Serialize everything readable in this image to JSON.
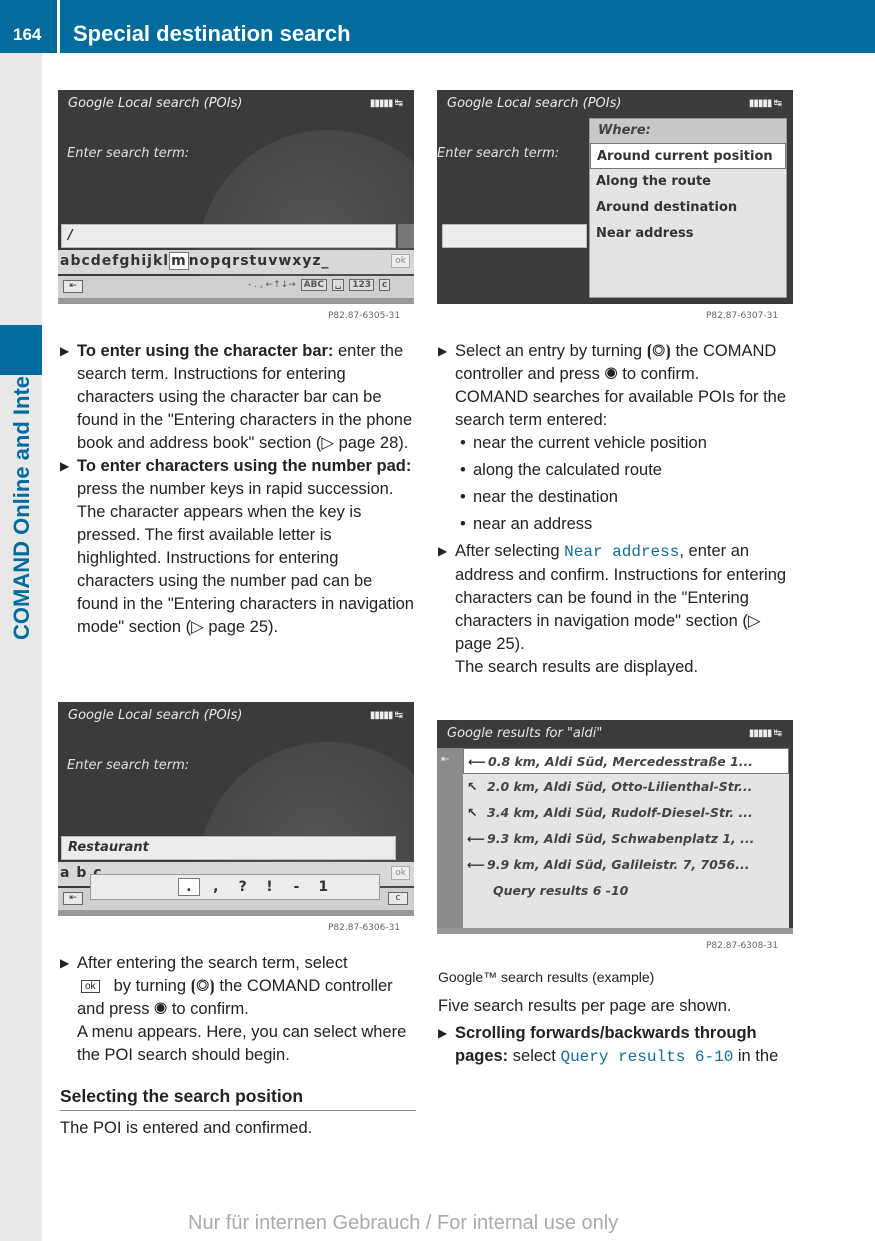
{
  "header": {
    "page_number": "164",
    "title": "Special destination search"
  },
  "sidebar": {
    "chapter": "COMAND Online and Internet"
  },
  "screens": {
    "s1": {
      "title": "Google Local search (POIs)",
      "status": "▮▮▮▮▮ ↹",
      "label": "Enter search term:",
      "input_value": "/",
      "charbar_before": "abcdefghijkl",
      "charbar_selected": "m",
      "charbar_after": "nopqrstuvwxyz_",
      "ok_key": "ok",
      "back_key": "⇤",
      "symbols": "- . , ←↑↓→",
      "keys": [
        "ABC",
        "␣",
        "123",
        "c"
      ],
      "figure_code": "P82.87-6305-31"
    },
    "s2": {
      "title": "Google Local search (POIs)",
      "status": "▮▮▮▮▮ ↹",
      "label": "Enter search term:",
      "menu_title": "Where:",
      "menu_items": [
        "Around current position",
        "Along the route",
        "Around destination",
        "Near address"
      ],
      "figure_code": "P82.87-6307-31"
    },
    "s3": {
      "title": "Google Local search (POIs)",
      "status": "▮▮▮▮▮ ↹",
      "label": "Enter search term:",
      "input_value": "Restaurant",
      "charbar_partial": "a b c",
      "punct_chars": [
        ".",
        ",",
        "?",
        "!",
        "-",
        "1"
      ],
      "ok_key": "ok",
      "back_key": "⇤",
      "c_key": "c",
      "figure_code": "P82.87-6306-31"
    },
    "s4": {
      "title": "Google results for \"aldi\"",
      "status": "▮▮▮▮▮ ↹",
      "back_key": "⇤",
      "results": [
        {
          "dir": "⟵",
          "text": "0.8 km, Aldi Süd, Mercedesstraße 1..."
        },
        {
          "dir": "↖",
          "text": "2.0 km, Aldi Süd, Otto-Lilienthal-Str..."
        },
        {
          "dir": "↖",
          "text": "3.4 km, Aldi Süd, Rudolf-Diesel-Str. ..."
        },
        {
          "dir": "⟵",
          "text": "9.3 km, Aldi Süd, Schwabenplatz 1, ..."
        },
        {
          "dir": "⟵",
          "text": "9.9 km, Aldi Süd, Galileistr. 7, 7056..."
        }
      ],
      "more": "Query results 6 -10",
      "figure_code": "P82.87-6308-31"
    }
  },
  "left_column": {
    "item1_bold": "To enter using the character bar:",
    "item1_text": " enter the search term. Instructions for entering characters using the character bar can be found in the \"Entering characters in the phone book and address book\" section (▷ page 28).",
    "item2_bold": "To enter characters using the number pad:",
    "item2_text": " press the number keys in rapid succession.",
    "item2_text2": "The character appears when the key is pressed. The first available letter is highlighted. Instructions for entering characters using the number pad can be found in the \"Entering characters in navigation mode\" section (▷ page 25).",
    "item3_a": "After entering the search term, select",
    "item3_ok": "ok",
    "item3_b": "by turning ⦗◎⦘ the COMAND controller and press ◉ to confirm.",
    "item3_c": "A menu appears. Here, you can select where the POI search should begin.",
    "section_heading": "Selecting the search position",
    "section_text": "The POI is entered and confirmed."
  },
  "right_column": {
    "item1_text": "Select an entry by turning ⦗◎⦘ the COMAND controller and press ◉ to confirm.",
    "item1_text2": "COMAND searches for available POIs for the search term entered:",
    "bullets": [
      "near the current vehicle position",
      "along the calculated route",
      "near the destination",
      "near an address"
    ],
    "item2_a": "After selecting ",
    "item2_code": "Near address",
    "item2_b": ", enter an address and confirm. Instructions for entering characters can be found in the \"Entering characters in navigation mode\" section (▷ page 25).",
    "item2_c": "The search results are displayed.",
    "caption": "Google™ search results (example)",
    "para": "Five search results per page are shown.",
    "item3_bold": "Scrolling forwards/backwards through pages:",
    "item3_a": " select ",
    "item3_code": "Query results 6-10",
    "item3_b": " in the"
  },
  "footer": {
    "stamp": "Nur für internen Gebrauch / For internal use only"
  }
}
